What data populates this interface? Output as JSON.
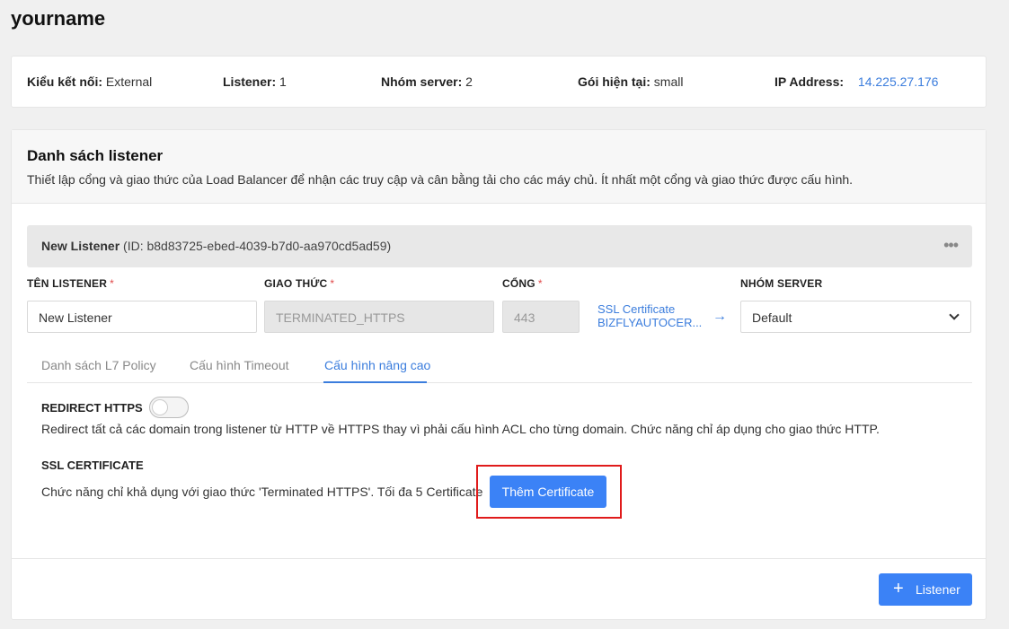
{
  "page": {
    "title": "yourname"
  },
  "info": {
    "connection_label": "Kiểu kết nối:",
    "connection_value": "External",
    "listener_label": "Listener:",
    "listener_value": "1",
    "server_group_label": "Nhóm server:",
    "server_group_value": "2",
    "plan_label": "Gói hiện tại:",
    "plan_value": "small",
    "ip_label": "IP Address:",
    "ip_value": "14.225.27.176"
  },
  "listener_section": {
    "title": "Danh sách listener",
    "description": "Thiết lập cổng và giao thức của Load Balancer để nhận các truy cập và cân bằng tải cho các máy chủ. Ít nhất một cổng và giao thức được cấu hình.",
    "listener": {
      "name": "New Listener",
      "id_text": "(ID: b8d83725-ebed-4039-b7d0-aa970cd5ad59)",
      "more": "•••"
    },
    "fields": {
      "name_label": "TÊN LISTENER",
      "name_value": "New Listener",
      "protocol_label": "GIAO THỨC",
      "protocol_value": "TERMINATED_HTTPS",
      "port_label": "CỔNG",
      "port_value": "443",
      "ssl_line1": "SSL Certificate",
      "ssl_line2": "BIZFLYAUTOCER...",
      "server_group_label": "NHÓM SERVER",
      "server_group_value": "Default",
      "required_mark": "*"
    },
    "tabs": [
      {
        "label": "Danh sách L7 Policy"
      },
      {
        "label": "Cấu hình Timeout"
      },
      {
        "label": "Cấu hình nâng cao"
      }
    ],
    "redirect": {
      "title": "REDIRECT HTTPS",
      "description": "Redirect tất cả các domain trong listener từ HTTP về HTTPS thay vì phải cấu hình ACL cho từng domain. Chức năng chỉ áp dụng cho giao thức HTTP."
    },
    "ssl": {
      "title": "SSL CERTIFICATE",
      "description": "Chức năng chỉ khả dụng với giao thức 'Terminated HTTPS'. Tối đa 5 Certificate",
      "add_button": "Thêm Certificate"
    },
    "add_listener_button": "Listener"
  }
}
